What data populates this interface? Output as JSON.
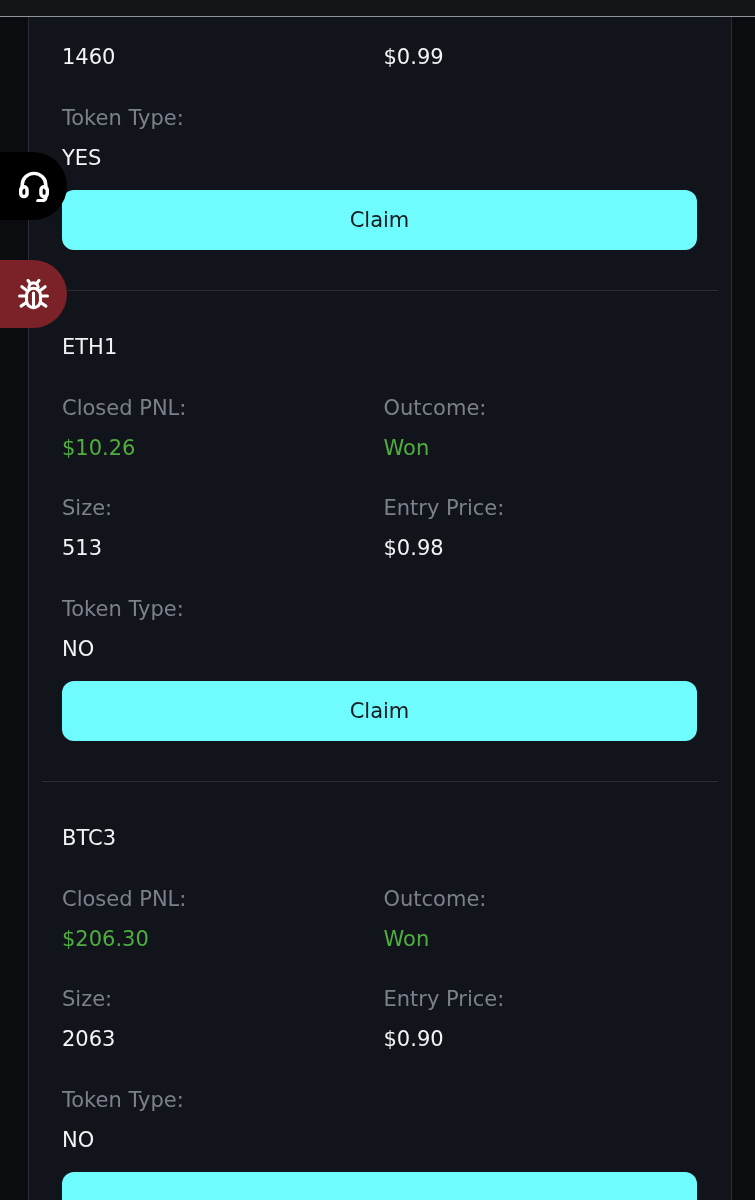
{
  "cards": [
    {
      "fields": [
        {
          "value": "1460",
          "color": "#f4f4f6"
        },
        {
          "value": "$0.99",
          "color": "#f4f4f6"
        },
        {
          "label": "Token Type:",
          "value": "YES",
          "color": "#f4f4f6"
        }
      ],
      "actions": [
        {
          "kind": "claim",
          "label": "Claim"
        }
      ]
    },
    {
      "title": "ETH1",
      "fields": [
        {
          "label": "Closed PNL:",
          "value": "$10.26",
          "color": "#4fae3e"
        },
        {
          "label": "Outcome:",
          "value": "Won",
          "color": "#4fae3e"
        },
        {
          "label": "Size:",
          "value": "513",
          "color": "#f4f4f6"
        },
        {
          "label": "Entry Price:",
          "value": "$0.98",
          "color": "#f4f4f6"
        },
        {
          "label": "Token Type:",
          "value": "NO",
          "color": "#f4f4f6"
        }
      ],
      "actions": [
        {
          "kind": "claim",
          "label": "Claim"
        }
      ]
    },
    {
      "title": "BTC3",
      "fields": [
        {
          "label": "Closed PNL:",
          "value": "$206.30",
          "color": "#4fae3e"
        },
        {
          "label": "Outcome:",
          "value": "Won",
          "color": "#4fae3e"
        },
        {
          "label": "Size:",
          "value": "2063",
          "color": "#f4f4f6"
        },
        {
          "label": "Entry Price:",
          "value": "$0.90",
          "color": "#f4f4f6"
        },
        {
          "label": "Token Type:",
          "value": "NO",
          "color": "#f4f4f6"
        }
      ],
      "actions": [
        {
          "kind": "claim"
        }
      ]
    }
  ]
}
